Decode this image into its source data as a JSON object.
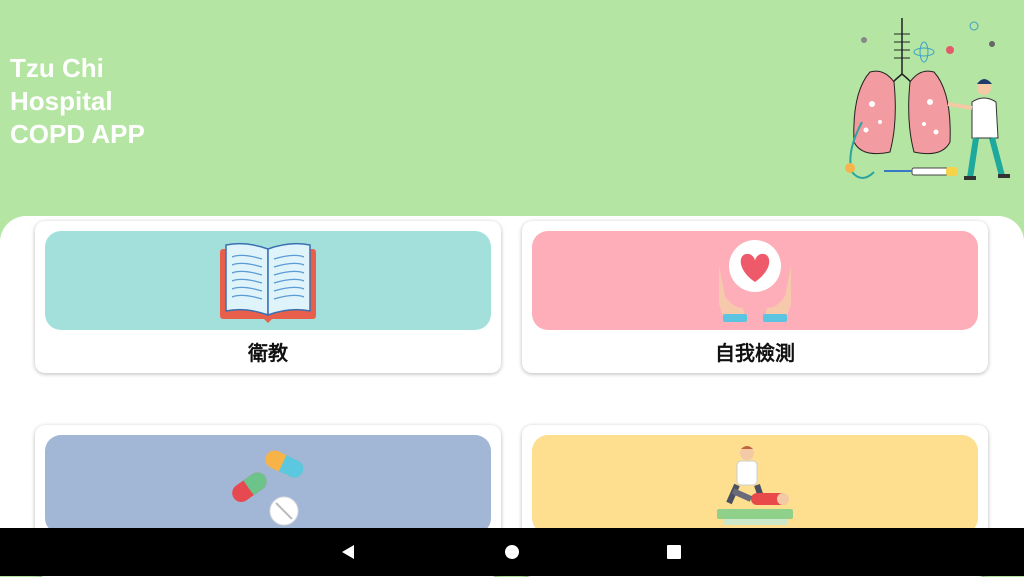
{
  "header": {
    "title": "Tzu Chi\nHospital\nCOPD APP",
    "background": "#b4e5a2"
  },
  "cards": [
    {
      "id": "education",
      "label": "衛教",
      "banner_color": "#a3e0dc",
      "icon": "open-book-icon"
    },
    {
      "id": "self-check",
      "label": "自我檢測",
      "banner_color": "#fdaeb8",
      "icon": "heart-hands-icon"
    },
    {
      "id": "medication",
      "label": "",
      "banner_color": "#a2b6d6",
      "icon": "pills-icon"
    },
    {
      "id": "rehab",
      "label": "",
      "banner_color": "#fddf8f",
      "icon": "physiotherapy-icon"
    }
  ],
  "navbar": {
    "back": "back-icon",
    "home": "home-icon",
    "recents": "recents-icon"
  }
}
